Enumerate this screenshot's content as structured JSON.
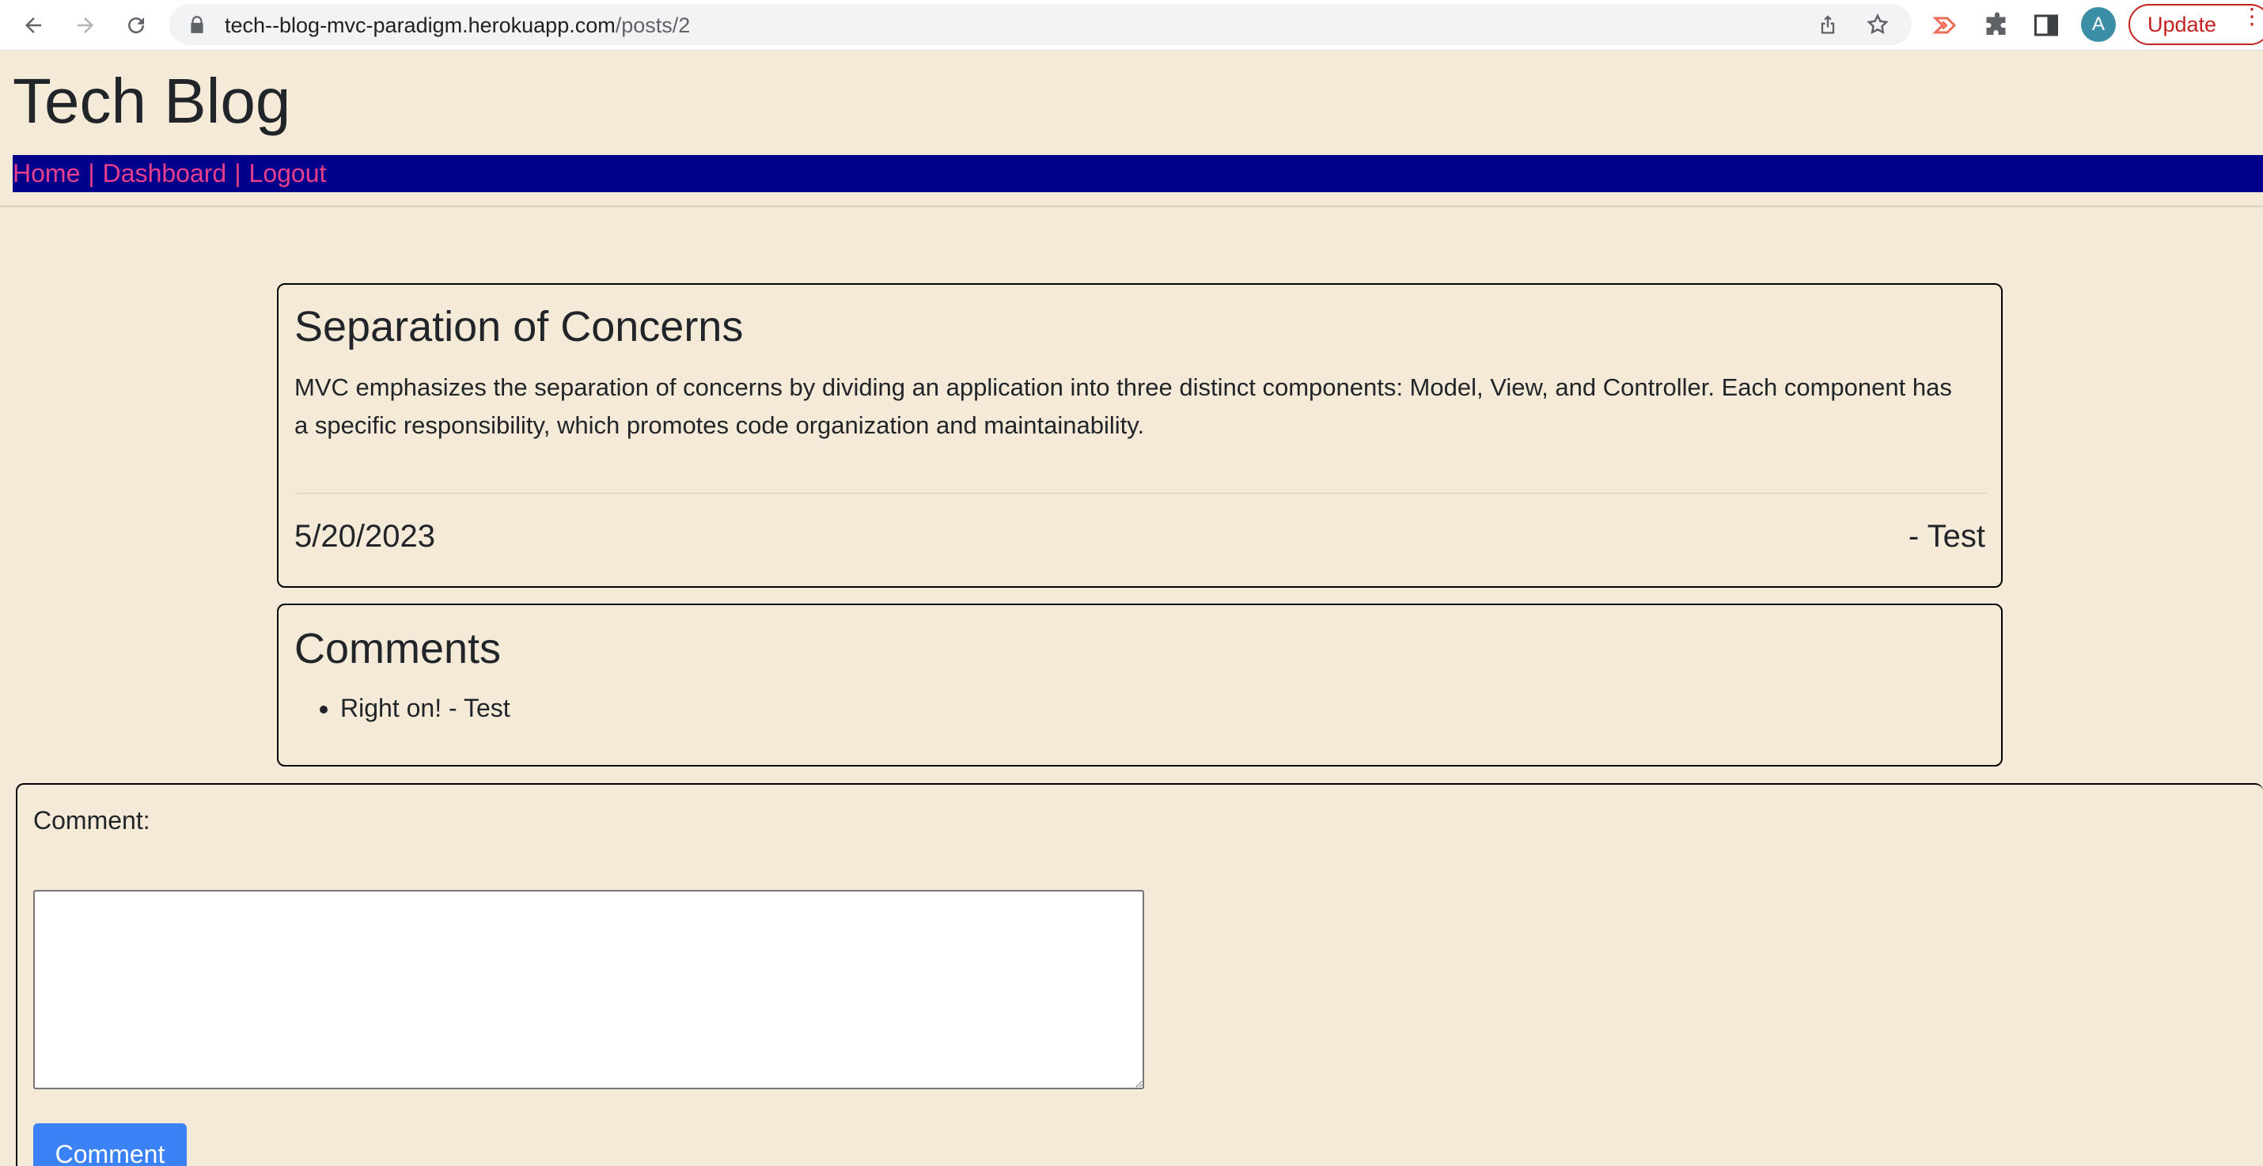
{
  "browser": {
    "url_host": "tech--blog-mvc-paradigm.herokuapp.com",
    "url_path": "/posts/2",
    "update_label": "Update",
    "avatar_initial": "A",
    "icons": [
      "back-arrow-icon",
      "forward-arrow-icon",
      "reload-icon",
      "lock-icon",
      "share-icon",
      "star-icon",
      "extension-cast-icon",
      "puzzle-icon",
      "side-panel-icon",
      "kebab-menu-icon"
    ]
  },
  "site": {
    "title": "Tech Blog"
  },
  "nav": {
    "home": "Home",
    "dashboard": "Dashboard",
    "logout": "Logout",
    "separator": "|",
    "colors": {
      "bar": "#00008b",
      "link": "#e83e8c"
    }
  },
  "post": {
    "title": "Separation of Concerns",
    "body": "MVC emphasizes the separation of concerns by dividing an application into three distinct components: Model, View, and Controller. Each component has a specific responsibility, which promotes code organization and maintainability.",
    "date": "5/20/2023",
    "author": "- Test"
  },
  "comments": {
    "title": "Comments",
    "items": [
      {
        "text": "Right on! - Test"
      }
    ]
  },
  "comment_form": {
    "label": "Comment:",
    "textarea_value": "",
    "submit_label": "Comment",
    "button_color": "#3b82f6"
  },
  "page_background": "#f5ead8"
}
